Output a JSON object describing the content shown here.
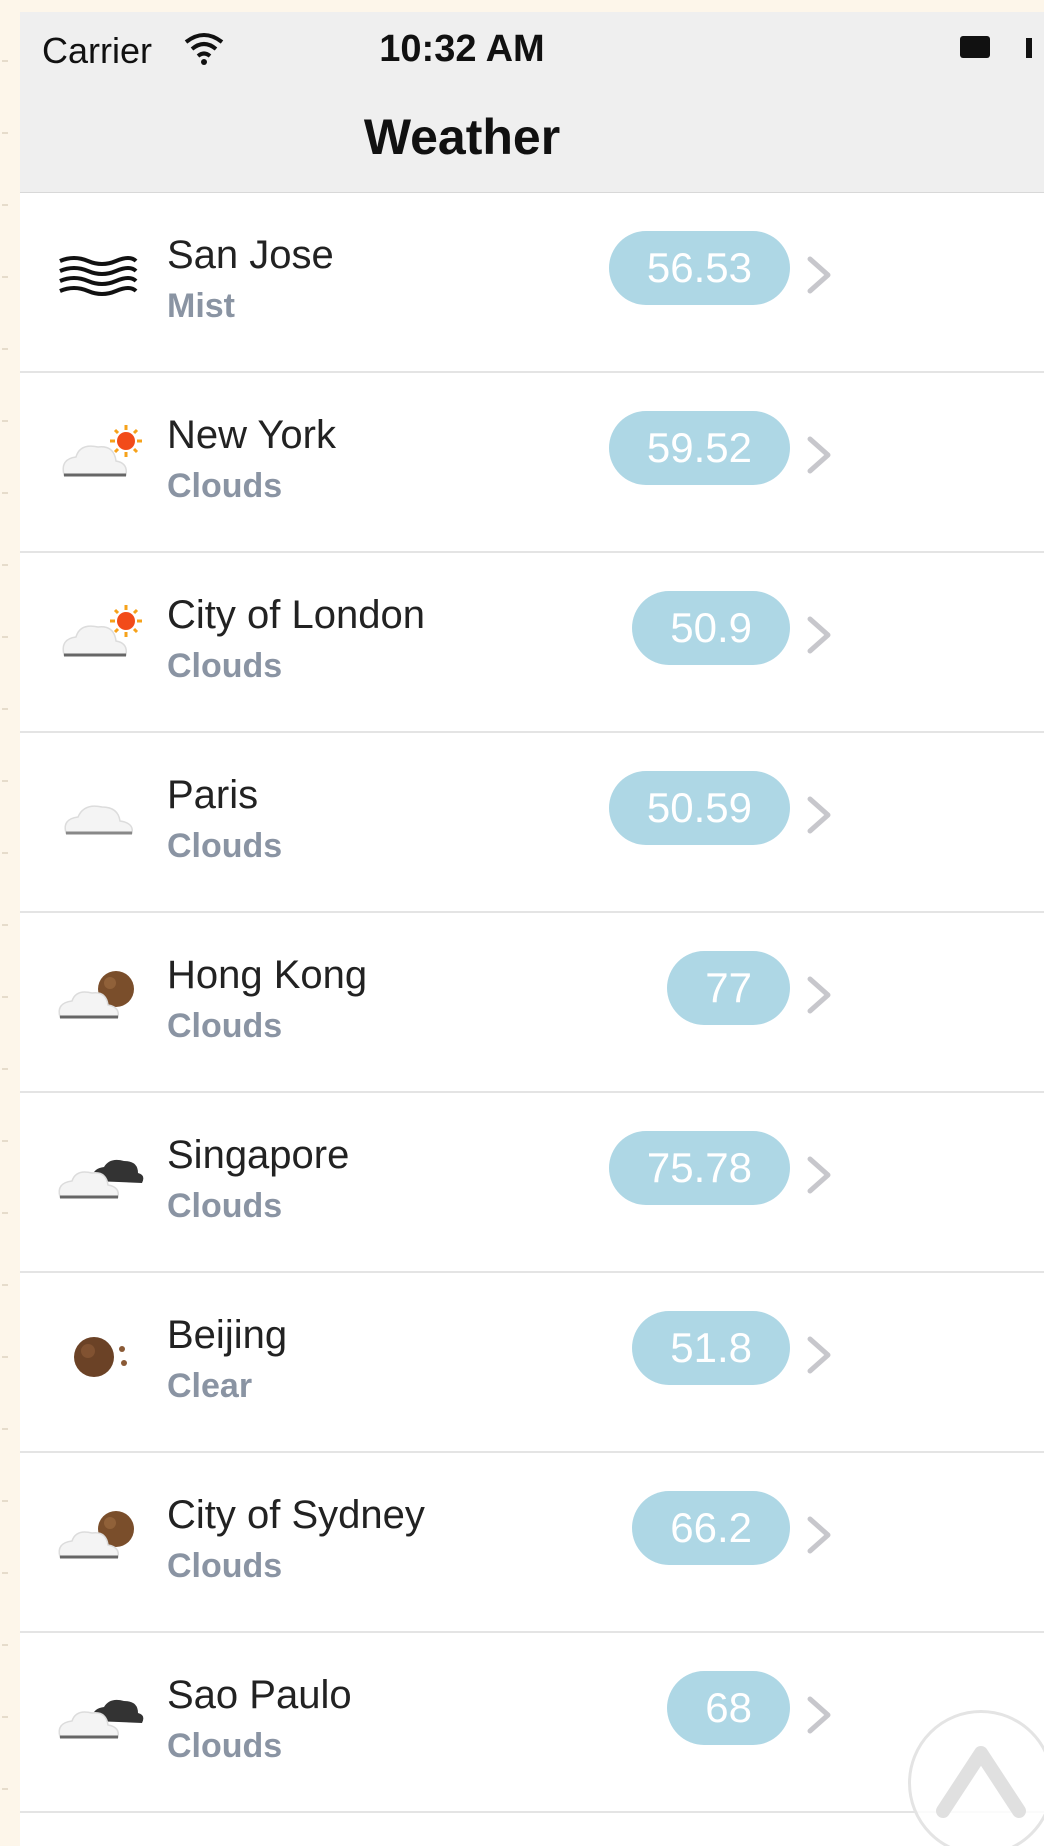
{
  "status_bar": {
    "carrier": "Carrier",
    "time": "10:32 AM"
  },
  "nav": {
    "title": "Weather"
  },
  "colors": {
    "temp_pill": "#aed7e5",
    "condition_text": "#8a94a3",
    "nav_bg": "#efefef"
  },
  "cities": [
    {
      "name": "San Jose",
      "condition": "Mist",
      "temp": "56.53",
      "icon": "mist-icon"
    },
    {
      "name": "New York",
      "condition": "Clouds",
      "temp": "59.52",
      "icon": "cloud-sun-icon"
    },
    {
      "name": "City of London",
      "condition": "Clouds",
      "temp": "50.9",
      "icon": "cloud-sun-icon"
    },
    {
      "name": "Paris",
      "condition": "Clouds",
      "temp": "50.59",
      "icon": "cloud-icon"
    },
    {
      "name": "Hong Kong",
      "condition": "Clouds",
      "temp": "77",
      "icon": "cloud-moon-icon"
    },
    {
      "name": "Singapore",
      "condition": "Clouds",
      "temp": "75.78",
      "icon": "cloud-dark-cloud-icon"
    },
    {
      "name": "Beijing",
      "condition": "Clear",
      "temp": "51.8",
      "icon": "moon-icon"
    },
    {
      "name": "City of Sydney",
      "condition": "Clouds",
      "temp": "66.2",
      "icon": "cloud-moon-icon"
    },
    {
      "name": "Sao Paulo",
      "condition": "Clouds",
      "temp": "68",
      "icon": "cloud-dark-cloud-icon"
    }
  ]
}
